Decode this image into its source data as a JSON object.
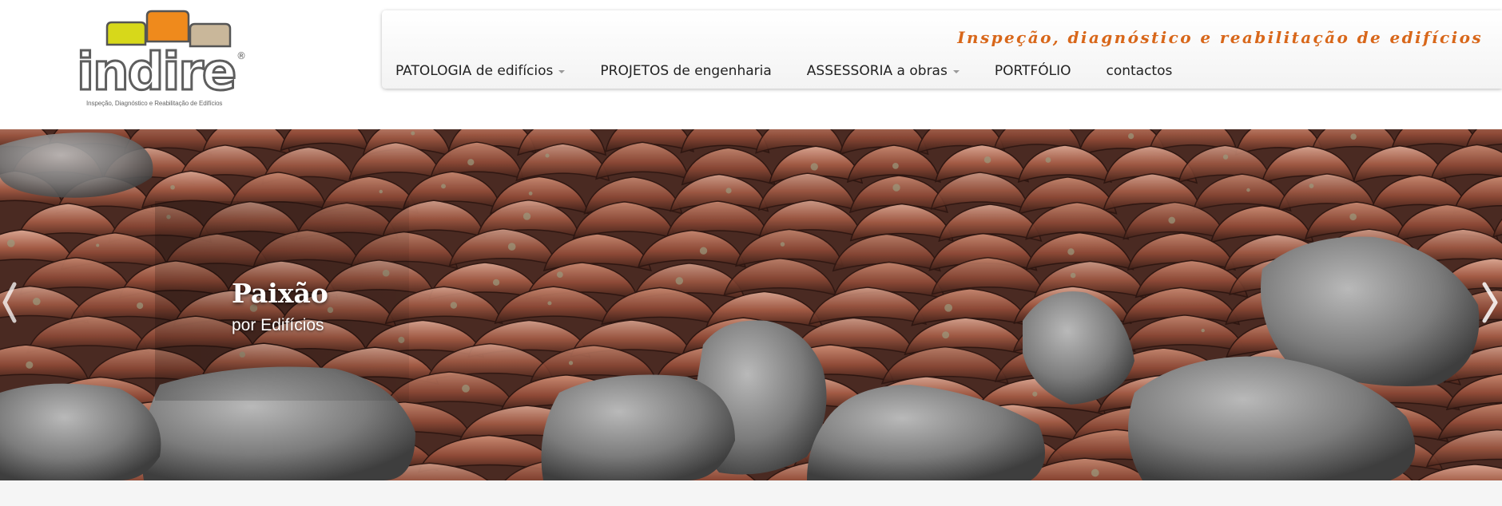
{
  "brand": {
    "logo_text": "indire",
    "logo_registered": "®",
    "logo_tagline": "Inspeção, Diagnóstico e Reabilitação de Edifícios",
    "logo_colors": [
      "#d7d81a",
      "#ef8a1c",
      "#c9b79a"
    ]
  },
  "header": {
    "tagline": "Inspeção, diagnóstico e reabilitação de edifícios",
    "tagline_color": "#d8671a"
  },
  "nav": {
    "items": [
      {
        "label": "PATOLOGIA de edifícios",
        "dropdown": true
      },
      {
        "label": "PROJETOS de engenharia",
        "dropdown": false
      },
      {
        "label": "ASSESSORIA a obras",
        "dropdown": true
      },
      {
        "label": "PORTFÓLIO",
        "dropdown": false
      },
      {
        "label": "contactos",
        "dropdown": false
      }
    ]
  },
  "hero": {
    "title": "Paixão",
    "subtitle": "por Edifícios",
    "image_subject": "old terracotta roof tiles with grey stones",
    "prev_icon": "chevron-left-icon",
    "next_icon": "chevron-right-icon"
  }
}
